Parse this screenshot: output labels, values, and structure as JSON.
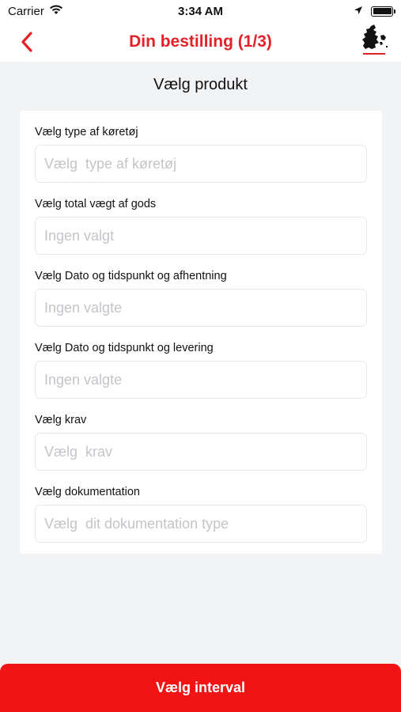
{
  "status_bar": {
    "carrier": "Carrier",
    "time": "3:34 AM"
  },
  "nav": {
    "title": "Din bestilling (1/3)",
    "accent_color": "#e32128"
  },
  "main": {
    "section_title": "Vælg produkt",
    "fields": [
      {
        "label": "Vælg type af køretøj",
        "placeholder": "Vælg  type af køretøj"
      },
      {
        "label": "Vælg total vægt af gods",
        "placeholder": "Ingen valgt"
      },
      {
        "label": "Vælg Dato og tidspunkt og afhentning",
        "placeholder": "Ingen valgte"
      },
      {
        "label": "Vælg Dato og tidspunkt og levering",
        "placeholder": "Ingen valgte"
      },
      {
        "label": "Vælg krav",
        "placeholder": "Vælg  krav"
      },
      {
        "label": "Vælg dokumentation",
        "placeholder": "Vælg  dit dokumentation type"
      }
    ]
  },
  "footer": {
    "button_label": "Vælg interval",
    "button_color": "#f01414"
  },
  "icons": [
    "wifi-icon",
    "location-arrow-icon",
    "battery-icon",
    "back-chevron-icon",
    "denmark-map-logo"
  ]
}
